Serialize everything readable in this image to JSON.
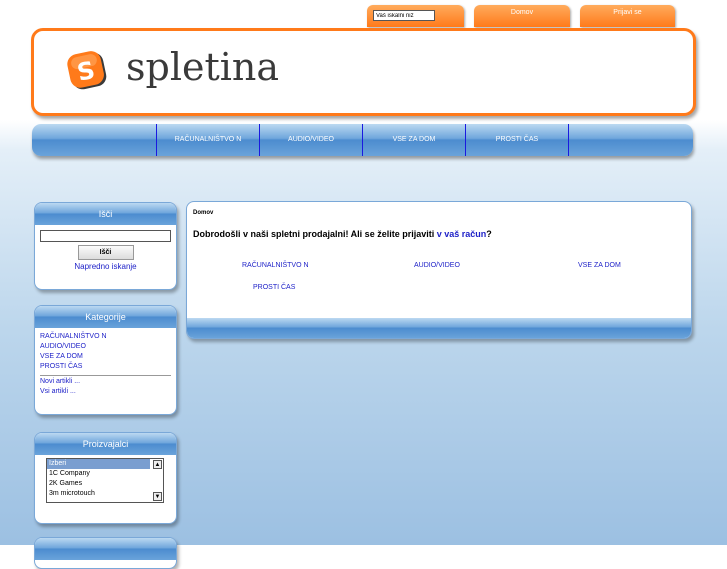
{
  "top": {
    "search_placeholder": "Vaš iskalni niz",
    "home_label": "Domov",
    "login_label": "Prijavi se"
  },
  "logo": {
    "letter": "S",
    "text": "spletina",
    "colors": {
      "orange": "#ff7a1a",
      "text": "#3a3a3a"
    }
  },
  "nav": {
    "items": [
      {
        "label": "RAČUNALNIŠTVO N"
      },
      {
        "label": "AUDIO/VIDEO"
      },
      {
        "label": "VSE ZA DOM"
      },
      {
        "label": "PROSTI ČAS"
      }
    ]
  },
  "search_box": {
    "title": "Išči",
    "button": "Išči",
    "advanced": "Napredno iskanje"
  },
  "categories": {
    "title": "Kategorije",
    "items": [
      "RAČUNALNIŠTVO N",
      "AUDIO/VIDEO",
      "VSE ZA DOM",
      "PROSTI ČAS"
    ],
    "new_items": "Novi artikli ...",
    "all_items": "Vsi artikli ..."
  },
  "manufacturers": {
    "title": "Proizvajalci",
    "options": [
      "Izberi",
      "1C Company",
      "2K Games",
      "3m microtouch"
    ]
  },
  "main": {
    "breadcrumb": "Domov",
    "welcome_text": "Dobrodošli v naši spletni prodajalni! Ali se želite prijaviti ",
    "welcome_link": "v vaš račun",
    "welcome_end": "?",
    "categories": [
      "RAČUNALNIŠTVO N",
      "AUDIO/VIDEO",
      "VSE ZA DOM",
      "PROSTI ČAS"
    ]
  },
  "colors": {
    "accent_orange": "#ff7a1a",
    "accent_blue": "#4c8ccf",
    "link": "#1f22c8"
  }
}
